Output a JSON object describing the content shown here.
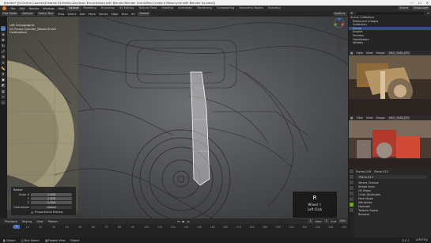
{
  "window": {
    "title": "Blender* [D:\\Online Courses\\Creative 92\\Harley-Davidson Knucklehead with Blender\\Blender Scene\\Mod Create a Motorcycle with Blender 04.blend]",
    "controls": [
      "—",
      "☐",
      "✕"
    ]
  },
  "menu": {
    "items": [
      "File",
      "Edit",
      "Render",
      "Window",
      "Help"
    ],
    "workspaces": [
      "Layout",
      "Modeling",
      "Sculpting",
      "UV Editing",
      "Texture Paint",
      "Shading",
      "Animation",
      "Rendering",
      "Compositing",
      "Geometry Nodes",
      "Scripting"
    ],
    "active_workspace": "Layout",
    "scene_label": "Scene",
    "view_layer_label": "ViewLayer"
  },
  "viewport_header": {
    "mode": "Edit Mode",
    "orientation": "Default",
    "drag": "Select Box",
    "menus": [
      "View",
      "Select",
      "Add",
      "Mesh",
      "Vertex",
      "Edge",
      "Face",
      "UV"
    ],
    "transform": "Global",
    "options": "Options",
    "version": "Version: 3.2.1"
  },
  "viewport_info": {
    "line1": "Left Orthographic",
    "line2": "(0) Frame Cylinder_Wheel15.001",
    "line3": "Centimeters"
  },
  "redo_panel": {
    "title": "Resize",
    "rows": [
      {
        "label": "Scale X",
        "value": "1.005"
      },
      {
        "label": "Y",
        "value": "1.005"
      },
      {
        "label": "Z",
        "value": "1.005"
      }
    ],
    "orientation_label": "Orientation",
    "orientation_value": "Global",
    "proportional": "Proportional Editing"
  },
  "key_overlay": {
    "key": "R",
    "action": "Wheel ↑",
    "mouse": "Left Click"
  },
  "timeline": {
    "menus": [
      "Playback",
      "Keying",
      "View",
      "Marker"
    ],
    "ticks": [
      "0",
      "10",
      "20",
      "30",
      "40",
      "50",
      "60",
      "70",
      "80",
      "90",
      "100",
      "110",
      "120",
      "130",
      "140",
      "150",
      "160",
      "170",
      "180",
      "190",
      "200",
      "210",
      "220",
      "230",
      "240",
      "250"
    ],
    "current_frame": "1",
    "start_label": "Start",
    "start": "1",
    "end_label": "End",
    "end": "250"
  },
  "outliner": {
    "title": "Scene Collection",
    "items": [
      "Reference Images",
      "Collection",
      "Frame",
      "Engine",
      "Fenders",
      "Handlebars",
      "Wheels"
    ],
    "search_placeholder": ""
  },
  "image_editor_1": {
    "menus": [
      "View",
      "View",
      "Image"
    ],
    "image_name": "IMG_1481.JPG"
  },
  "image_editor_2": {
    "menus": [
      "View",
      "View",
      "Image"
    ],
    "image_name": "IMG_1462.JPG"
  },
  "properties": {
    "object_name": "Frame.016",
    "mesh_name": "Plane.012",
    "data_name": "Plane.012",
    "sections": [
      "Vertex Groups",
      "Shape Keys",
      "UV Maps",
      "Color Attributes",
      "Face Maps",
      "Attributes",
      "Normals",
      "Texture Space",
      "Remesh"
    ]
  },
  "statusbar": {
    "left": "Select",
    "middle": "Box Select",
    "right": "Rotate View",
    "context": "Object",
    "version": "3.2.1",
    "watermark": "udemy"
  },
  "colors": {
    "accent": "#4772b3",
    "blender_orange": "#e87d0d",
    "ui_bg": "#2b2b2b"
  }
}
